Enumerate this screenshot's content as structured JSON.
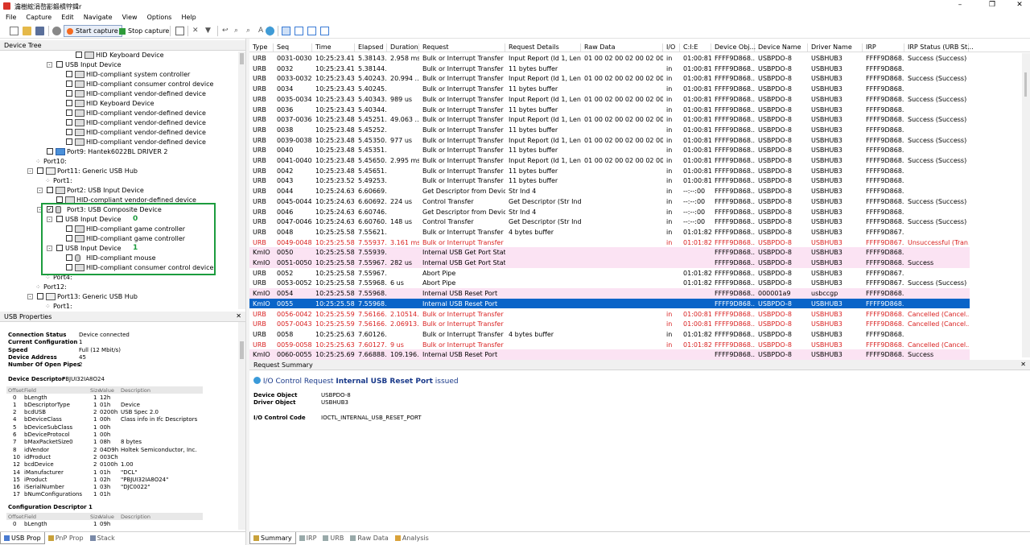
{
  "window": {
    "title": "瀹樹綋涓嶅彲鍛樻牸鍓r",
    "controls": [
      "–",
      "❐",
      "✕"
    ]
  },
  "menu": [
    "File",
    "Capture",
    "Edit",
    "Navigate",
    "View",
    "Options",
    "Help"
  ],
  "toolbar": {
    "start_capture": "Start capture",
    "stop_capture": "Stop capture"
  },
  "device_tree": {
    "title": "Device Tree",
    "nodes": [
      {
        "label": "HID Keyboard Device",
        "indent": 4,
        "expander": "",
        "check": true,
        "icon": "keyboard-icon"
      },
      {
        "label": "USB Input Device",
        "indent": 2,
        "expander": "-",
        "check": true,
        "icon": ""
      },
      {
        "label": "HID-compliant system controller",
        "indent": 3,
        "expander": "",
        "check": true,
        "icon": "hid-icon"
      },
      {
        "label": "HID-compliant consumer control device",
        "indent": 3,
        "expander": "",
        "check": true,
        "icon": "hid-icon"
      },
      {
        "label": "HID-compliant vendor-defined device",
        "indent": 3,
        "expander": "",
        "check": true,
        "icon": "hid-icon"
      },
      {
        "label": "HID Keyboard Device",
        "indent": 3,
        "expander": "",
        "check": true,
        "icon": "keyboard-icon"
      },
      {
        "label": "HID-compliant vendor-defined device",
        "indent": 3,
        "expander": "",
        "check": true,
        "icon": "hid-icon"
      },
      {
        "label": "HID-compliant vendor-defined device",
        "indent": 3,
        "expander": "",
        "check": true,
        "icon": "hid-icon"
      },
      {
        "label": "HID-compliant vendor-defined device",
        "indent": 3,
        "expander": "",
        "check": true,
        "icon": "hid-icon"
      },
      {
        "label": "HID-compliant vendor-defined device",
        "indent": 3,
        "expander": "",
        "check": true,
        "icon": "hid-icon"
      },
      {
        "label": "Port9: Hantek6022BL DRIVER 2",
        "indent": 1,
        "expander": "",
        "check": true,
        "icon": "device-icon"
      },
      {
        "label": "Port10:",
        "indent": 0,
        "expander": "",
        "check": false,
        "icon": "port-icon"
      },
      {
        "label": "Port11: Generic USB Hub",
        "indent": 0,
        "expander": "-",
        "check": true,
        "icon": "hub-icon"
      },
      {
        "label": "Port1:",
        "indent": 1,
        "expander": "",
        "check": false,
        "icon": "port-icon"
      },
      {
        "label": "Port2: USB Input Device",
        "indent": 1,
        "expander": "-",
        "check": true,
        "icon": "hid-icon"
      },
      {
        "label": "HID-compliant vendor-defined device",
        "indent": 2,
        "expander": "",
        "check": true,
        "icon": "hid-icon"
      },
      {
        "label": "Port3: USB Composite Device",
        "indent": 1,
        "expander": "-",
        "check": true,
        "checked": true,
        "icon": "usb-icon"
      },
      {
        "label": "USB Input Device",
        "indent": 2,
        "expander": "-",
        "check": true,
        "icon": "",
        "annot": "0"
      },
      {
        "label": "HID-compliant game controller",
        "indent": 3,
        "expander": "",
        "check": true,
        "icon": "hid-icon"
      },
      {
        "label": "HID-compliant game controller",
        "indent": 3,
        "expander": "",
        "check": true,
        "icon": "hid-icon"
      },
      {
        "label": "USB Input Device",
        "indent": 2,
        "expander": "-",
        "check": true,
        "icon": "",
        "annot": "1"
      },
      {
        "label": "HID-compliant mouse",
        "indent": 3,
        "expander": "",
        "check": true,
        "icon": "mouse-icon"
      },
      {
        "label": "HID-compliant consumer control device",
        "indent": 3,
        "expander": "",
        "check": true,
        "icon": "hid-icon"
      },
      {
        "label": "Port4:",
        "indent": 1,
        "expander": "",
        "check": false,
        "icon": "port-icon"
      },
      {
        "label": "Port12:",
        "indent": 0,
        "expander": "",
        "check": false,
        "icon": "port-icon"
      },
      {
        "label": "Port13: Generic USB Hub",
        "indent": 0,
        "expander": "-",
        "check": true,
        "icon": "hub-icon"
      },
      {
        "label": "Port1:",
        "indent": 1,
        "expander": "",
        "check": false,
        "icon": "port-icon"
      }
    ]
  },
  "usb_props": {
    "title": "USB Properties",
    "summary": [
      [
        "Connection Status",
        "Device connected"
      ],
      [
        "Current Configuration",
        "1"
      ],
      [
        "Speed",
        "Full (12 Mbit/s)"
      ],
      [
        "Device Address",
        "45"
      ],
      [
        "Number Of Open Pipes",
        "2"
      ]
    ],
    "device_descriptor_title": "Device Descriptor",
    "device_descriptor_serial": "PBJUI32IA8O24",
    "desc_headers": [
      "Offset",
      "Field",
      "Size",
      "Value",
      "Description"
    ],
    "desc_rows": [
      [
        "0",
        "bLength",
        "1",
        "12h",
        ""
      ],
      [
        "1",
        "bDescriptorType",
        "1",
        "01h",
        "Device"
      ],
      [
        "2",
        "bcdUSB",
        "2",
        "0200h",
        "USB Spec 2.0"
      ],
      [
        "4",
        "bDeviceClass",
        "1",
        "00h",
        "Class info in Ifc Descriptors"
      ],
      [
        "5",
        "bDeviceSubClass",
        "1",
        "00h",
        ""
      ],
      [
        "6",
        "bDeviceProtocol",
        "1",
        "00h",
        ""
      ],
      [
        "7",
        "bMaxPacketSize0",
        "1",
        "08h",
        "8 bytes"
      ],
      [
        "8",
        "idVendor",
        "2",
        "04D9h",
        "Holtek Semiconductor, Inc."
      ],
      [
        "10",
        "idProduct",
        "2",
        "003Ch",
        ""
      ],
      [
        "12",
        "bcdDevice",
        "2",
        "0100h",
        "1.00"
      ],
      [
        "14",
        "iManufacturer",
        "1",
        "01h",
        "\"DCL\""
      ],
      [
        "15",
        "iProduct",
        "1",
        "02h",
        "\"PBJUI32IA8O24\""
      ],
      [
        "16",
        "iSerialNumber",
        "1",
        "03h",
        "\"DJC0022\""
      ],
      [
        "17",
        "bNumConfigurations",
        "1",
        "01h",
        ""
      ]
    ],
    "config_descriptor_title": "Configuration Descriptor 1",
    "config_rows": [
      [
        "0",
        "bLength",
        "1",
        "09h",
        ""
      ]
    ]
  },
  "left_tabs": [
    "USB Prop",
    "PnP Prop",
    "Stack"
  ],
  "grid": {
    "headers": [
      "Type",
      "Seq",
      "Time",
      "Elapsed",
      "Duration",
      "Request",
      "Request Details",
      "Raw Data",
      "I/O",
      "C:I:E",
      "Device Obj...",
      "Device Name",
      "Driver Name",
      "IRP",
      "IRP Status (URB St..."
    ],
    "rows": [
      [
        "URB",
        "0031-0030",
        "10:25:23.411",
        "5.38143...",
        "2.958 ms",
        "Bulk or Interrupt Transfer",
        "Input Report (Id 1, Len ...",
        "01 00 02 00 02 00 02 00 ...",
        "in",
        "01:00:81",
        "FFFF9D868...",
        "USBPDO-8",
        "USBHUB3",
        "FFFF9D868...",
        "Success (Success)",
        "n"
      ],
      [
        "URB",
        "0032",
        "10:25:23.411",
        "5.38144...",
        "",
        "Bulk or Interrupt Transfer",
        "11 bytes buffer",
        "",
        "in",
        "01:00:81",
        "FFFF9D868...",
        "USBPDO-8",
        "USBHUB3",
        "FFFF9D868...",
        "",
        "n"
      ],
      [
        "URB",
        "0033-0032",
        "10:25:23.432",
        "5.40243...",
        "20.994 ...",
        "Bulk or Interrupt Transfer",
        "Input Report (Id 1, Len ...",
        "01 00 02 00 02 00 02 00 ...",
        "in",
        "01:00:81",
        "FFFF9D868...",
        "USBPDO-8",
        "USBHUB3",
        "FFFF9D868...",
        "Success (Success)",
        "n"
      ],
      [
        "URB",
        "0034",
        "10:25:23.432",
        "5.40245...",
        "",
        "Bulk or Interrupt Transfer",
        "11 bytes buffer",
        "",
        "in",
        "01:00:81",
        "FFFF9D868...",
        "USBPDO-8",
        "USBHUB3",
        "FFFF9D868...",
        "",
        "n"
      ],
      [
        "URB",
        "0035-0034",
        "10:25:23.433",
        "5.40343...",
        "989 us",
        "Bulk or Interrupt Transfer",
        "Input Report (Id 1, Len ...",
        "01 00 02 00 02 00 02 00 ...",
        "in",
        "01:00:81",
        "FFFF9D868...",
        "USBPDO-8",
        "USBHUB3",
        "FFFF9D868...",
        "Success (Success)",
        "n"
      ],
      [
        "URB",
        "0036",
        "10:25:23.433",
        "5.40344...",
        "",
        "Bulk or Interrupt Transfer",
        "11 bytes buffer",
        "",
        "in",
        "01:00:81",
        "FFFF9D868...",
        "USBPDO-8",
        "USBHUB3",
        "FFFF9D868...",
        "",
        "n"
      ],
      [
        "URB",
        "0037-0036",
        "10:25:23.482",
        "5.45251...",
        "49.063 ...",
        "Bulk or Interrupt Transfer",
        "Input Report (Id 1, Len ...",
        "01 00 02 00 02 00 02 00 ...",
        "in",
        "01:00:81",
        "FFFF9D868...",
        "USBPDO-8",
        "USBHUB3",
        "FFFF9D868...",
        "Success (Success)",
        "n"
      ],
      [
        "URB",
        "0038",
        "10:25:23.482",
        "5.45252...",
        "",
        "Bulk or Interrupt Transfer",
        "11 bytes buffer",
        "",
        "in",
        "01:00:81",
        "FFFF9D868...",
        "USBPDO-8",
        "USBHUB3",
        "FFFF9D868...",
        "",
        "n"
      ],
      [
        "URB",
        "0039-0038",
        "10:25:23.483",
        "5.45350...",
        "977 us",
        "Bulk or Interrupt Transfer",
        "Input Report (Id 1, Len ...",
        "01 00 02 00 02 00 02 00 ...",
        "in",
        "01:00:81",
        "FFFF9D868...",
        "USBPDO-8",
        "USBHUB3",
        "FFFF9D868...",
        "Success (Success)",
        "n"
      ],
      [
        "URB",
        "0040",
        "10:25:23.483",
        "5.45351...",
        "",
        "Bulk or Interrupt Transfer",
        "11 bytes buffer",
        "",
        "in",
        "01:00:81",
        "FFFF9D868...",
        "USBPDO-8",
        "USBHUB3",
        "FFFF9D868...",
        "",
        "n"
      ],
      [
        "URB",
        "0041-0040",
        "10:25:23.486",
        "5.45650...",
        "2.995 ms",
        "Bulk or Interrupt Transfer",
        "Input Report (Id 1, Len ...",
        "01 00 02 00 02 00 02 00 ...",
        "in",
        "01:00:81",
        "FFFF9D868...",
        "USBPDO-8",
        "USBHUB3",
        "FFFF9D868...",
        "Success (Success)",
        "n"
      ],
      [
        "URB",
        "0042",
        "10:25:23.486",
        "5.45651...",
        "",
        "Bulk or Interrupt Transfer",
        "11 bytes buffer",
        "",
        "in",
        "01:00:81",
        "FFFF9D868...",
        "USBPDO-8",
        "USBHUB3",
        "FFFF9D868...",
        "",
        "n"
      ],
      [
        "URB",
        "0043",
        "10:25:23.523",
        "5.49253...",
        "",
        "Bulk or Interrupt Transfer",
        "11 bytes buffer",
        "",
        "in",
        "01:00:81",
        "FFFF9D868...",
        "USBPDO-8",
        "USBHUB3",
        "FFFF9D868...",
        "",
        "n"
      ],
      [
        "URB",
        "0044",
        "10:25:24.637",
        "6.60669...",
        "",
        "Get Descriptor from Device",
        "Str Ind 4",
        "",
        "in",
        "--:--:00",
        "FFFF9D868...",
        "USBPDO-8",
        "USBHUB3",
        "FFFF9D868...",
        "",
        "n"
      ],
      [
        "URB",
        "0045-0044",
        "10:25:24.637",
        "6.60692...",
        "224 us",
        "Control Transfer",
        "Get Descriptor (Str Ind 4)",
        "",
        "in",
        "--:--:00",
        "FFFF9D868...",
        "USBPDO-8",
        "USBHUB3",
        "FFFF9D868...",
        "Success (Success)",
        "n"
      ],
      [
        "URB",
        "0046",
        "10:25:24.637",
        "6.60746...",
        "",
        "Get Descriptor from Device",
        "Str Ind 4",
        "",
        "in",
        "--:--:00",
        "FFFF9D868...",
        "USBPDO-8",
        "USBHUB3",
        "FFFF9D868...",
        "",
        "n"
      ],
      [
        "URB",
        "0047-0046",
        "10:25:24.638",
        "6.60760...",
        "148 us",
        "Control Transfer",
        "Get Descriptor (Str Ind 4)",
        "",
        "in",
        "--:--:00",
        "FFFF9D868...",
        "USBPDO-8",
        "USBHUB3",
        "FFFF9D868...",
        "Success (Success)",
        "n"
      ],
      [
        "URB",
        "0048",
        "10:25:25.586",
        "7.55621...",
        "",
        "Bulk or Interrupt Transfer",
        "4 bytes buffer",
        "",
        "in",
        "01:01:82",
        "FFFF9D868...",
        "USBPDO-8",
        "USBHUB3",
        "FFFF9D867...",
        "",
        "n"
      ],
      [
        "URB",
        "0049-0048",
        "10:25:25.589",
        "7.55937...",
        "3.161 ms",
        "Bulk or Interrupt Transfer",
        "",
        "",
        "in",
        "01:01:82",
        "FFFF9D868...",
        "USBPDO-8",
        "USBHUB3",
        "FFFF9D867...",
        "Unsuccessful (Tran...",
        "r"
      ],
      [
        "KmIO",
        "0050",
        "10:25:25.589",
        "7.55939...",
        "",
        "Internal USB Get Port Status",
        "",
        "",
        "",
        "",
        "FFFF9D868...",
        "USBPDO-8",
        "USBHUB3",
        "FFFF9D868...",
        "",
        "p"
      ],
      [
        "KmIO",
        "0051-0050",
        "10:25:25.589",
        "7.55967...",
        "282 us",
        "Internal USB Get Port Status",
        "",
        "",
        "",
        "",
        "FFFF9D868...",
        "USBPDO-8",
        "USBHUB3",
        "FFFF9D868...",
        "Success",
        "p"
      ],
      [
        "URB",
        "0052",
        "10:25:25.589",
        "7.55967...",
        "",
        "Abort Pipe",
        "",
        "",
        "",
        "01:01:82",
        "FFFF9D868...",
        "USBPDO-8",
        "USBHUB3",
        "FFFF9D867...",
        "",
        "n"
      ],
      [
        "URB",
        "0053-0052",
        "10:25:25.589",
        "7.55968...",
        "6 us",
        "Abort Pipe",
        "",
        "",
        "",
        "01:01:82",
        "FFFF9D868...",
        "USBPDO-8",
        "USBHUB3",
        "FFFF9D867...",
        "Success (Success)",
        "n"
      ],
      [
        "KmIO",
        "0054",
        "10:25:25.589",
        "7.55968...",
        "",
        "Internal USB Reset Port",
        "",
        "",
        "",
        "",
        "FFFF9D868...",
        "000001a9",
        "usbccgp",
        "FFFF9D868...",
        "",
        "p"
      ],
      [
        "KmIO",
        "0055",
        "10:25:25.589",
        "7.55968...",
        "",
        "Internal USB Reset Port",
        "",
        "",
        "",
        "",
        "FFFF9D868...",
        "USBPDO-8",
        "USBHUB3",
        "FFFF9D868...",
        "",
        "s"
      ],
      [
        "URB",
        "0056-0042",
        "10:25:25.591",
        "7.56166...",
        "2.10514...",
        "Bulk or Interrupt Transfer",
        "",
        "",
        "in",
        "01:00:81",
        "FFFF9D868...",
        "USBPDO-8",
        "USBHUB3",
        "FFFF9D868...",
        "Cancelled (Cancel...",
        "r"
      ],
      [
        "URB",
        "0057-0043",
        "10:25:25.591",
        "7.56166...",
        "2.06913...",
        "Bulk or Interrupt Transfer",
        "",
        "",
        "in",
        "01:00:81",
        "FFFF9D868...",
        "USBPDO-8",
        "USBHUB3",
        "FFFF9D868...",
        "Cancelled (Cancel...",
        "r"
      ],
      [
        "URB",
        "0058",
        "10:25:25.631",
        "7.60126...",
        "",
        "Bulk or Interrupt Transfer",
        "4 bytes buffer",
        "",
        "in",
        "01:01:82",
        "FFFF9D868...",
        "USBPDO-8",
        "USBHUB3",
        "FFFF9D868...",
        "",
        "n"
      ],
      [
        "URB",
        "0059-0058",
        "10:25:25.631",
        "7.60127...",
        "9 us",
        "Bulk or Interrupt Transfer",
        "",
        "",
        "in",
        "01:01:82",
        "FFFF9D868...",
        "USBPDO-8",
        "USBHUB3",
        "FFFF9D868...",
        "Cancelled (Cancel...",
        "r"
      ],
      [
        "KmIO",
        "0060-0055",
        "10:25:25.698",
        "7.66888...",
        "109.196...",
        "Internal USB Reset Port",
        "",
        "",
        "",
        "",
        "FFFF9D868...",
        "USBPDO-8",
        "USBHUB3",
        "FFFF9D868...",
        "Success",
        "p"
      ]
    ]
  },
  "summary": {
    "title": "Request Summary",
    "heading_prefix": "I/O Control Request",
    "heading_bold": "Internal USB Reset Port",
    "heading_suffix": "issued",
    "device_object_label": "Device Object",
    "device_object": "USBPDO-8",
    "driver_object_label": "Driver Object",
    "driver_object": "USBHUB3",
    "io_code_label": "I/O Control Code",
    "io_code": "IOCTL_INTERNAL_USB_RESET_PORT"
  },
  "bottom_tabs": [
    "Summary",
    "IRP",
    "URB",
    "Raw Data",
    "Analysis"
  ],
  "colors": {
    "selected": "#0a64c8",
    "pink": "#fbe3f3",
    "error": "#d92020",
    "highlight_box": "#1c9c3e",
    "annot": "#1c9c3e"
  }
}
